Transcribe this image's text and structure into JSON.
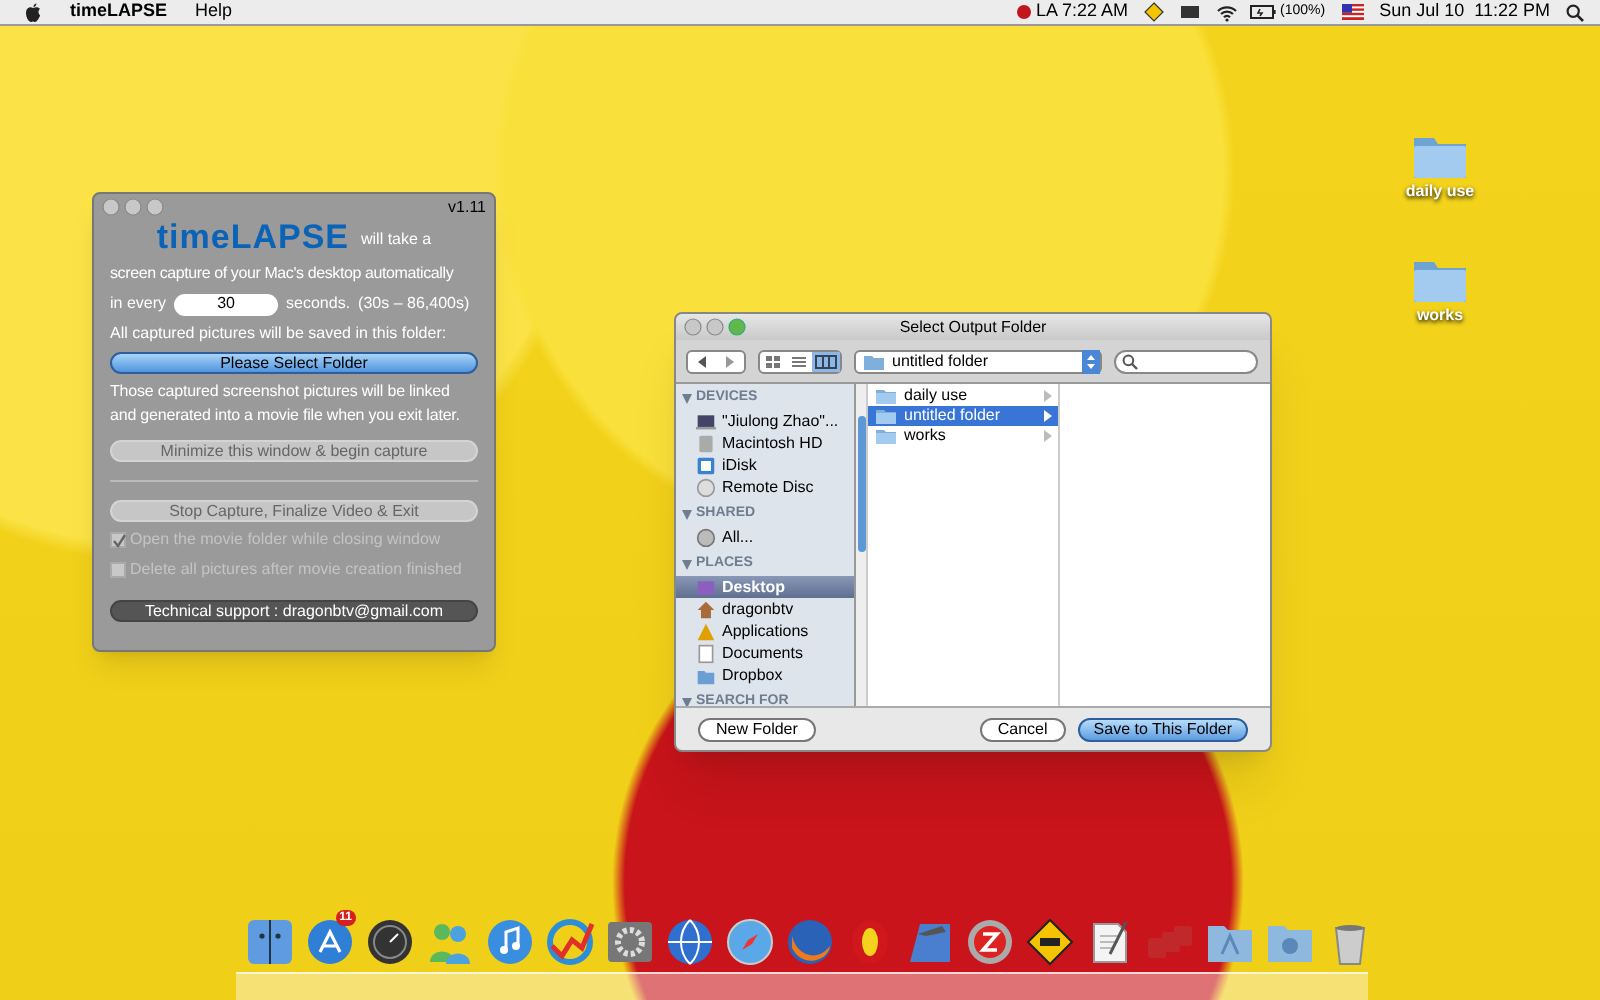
{
  "menu_bar": {
    "app_name": "timeLAPSE",
    "items": [
      "Help"
    ],
    "clock_1": "LA 7:22 AM",
    "battery": "(100%)",
    "date_time": "Sun Jul 10  11:22 PM"
  },
  "desktop_icons": [
    {
      "label": "daily use"
    },
    {
      "label": "works"
    }
  ],
  "app_window": {
    "version": "v1.11",
    "logo": "timeLAPSE",
    "intro": "will take a",
    "intro_2": "screen capture of your Mac's desktop automatically",
    "interval": {
      "prefix": "in every",
      "value": "30",
      "suffix": "seconds.",
      "range": "(30s – 86,400s)"
    },
    "save_note": "All captured pictures will be saved in this folder:",
    "select_button": {
      "label": "Please Select Folder",
      "disabled": false
    },
    "link_note": "Those captured screenshot pictures will be linked and generated into a movie file when you exit later.",
    "minimize_button": {
      "label": "Minimize this window & begin capture",
      "disabled": true
    },
    "stop_button": {
      "label": "Stop Capture, Finalize Video & Exit",
      "disabled": true
    },
    "options": [
      {
        "label": "Open the movie folder while closing window",
        "checked": true,
        "disabled": true
      },
      {
        "label": "Delete all pictures after movie creation finished",
        "checked": false,
        "disabled": true
      }
    ],
    "support": "Technical support : dragonbtv@gmail.com"
  },
  "dialog": {
    "title": "Select Output Folder",
    "path": "untitled folder",
    "sidebar": [
      {
        "heading": "DEVICES",
        "items": [
          {
            "label": "\"Jiulong Zhao\"...",
            "selected": false
          },
          {
            "label": "Macintosh HD",
            "selected": false
          },
          {
            "label": "iDisk",
            "selected": false
          },
          {
            "label": "Remote Disc",
            "selected": false
          }
        ]
      },
      {
        "heading": "SHARED",
        "items": [
          {
            "label": "All...",
            "selected": false
          }
        ]
      },
      {
        "heading": "PLACES",
        "items": [
          {
            "label": "Desktop",
            "selected": true
          },
          {
            "label": "dragonbtv",
            "selected": false
          },
          {
            "label": "Applications",
            "selected": false
          },
          {
            "label": "Documents",
            "selected": false
          },
          {
            "label": "Dropbox",
            "selected": false
          }
        ]
      },
      {
        "heading": "SEARCH FOR"
      }
    ],
    "folders": [
      {
        "label": "daily use",
        "selected": false
      },
      {
        "label": "untitled folder",
        "selected": true
      },
      {
        "label": "works",
        "selected": false
      }
    ],
    "new_folder_button": "New Folder",
    "cancel_button": "Cancel",
    "save_button": "Save to This Folder"
  },
  "dock": {
    "badge": "11"
  }
}
